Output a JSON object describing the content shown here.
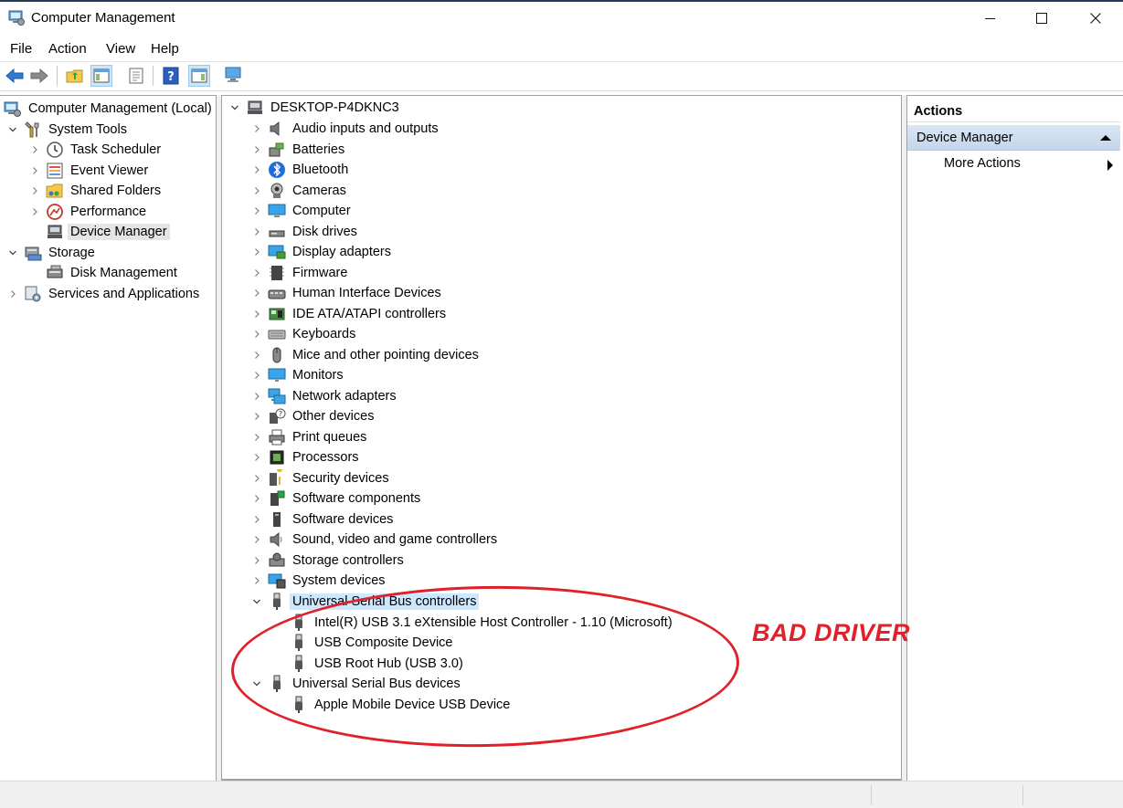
{
  "window": {
    "title": "Computer Management"
  },
  "menu": [
    "File",
    "Action",
    "View",
    "Help"
  ],
  "left_tree": {
    "root": "Computer Management (Local)",
    "system_tools": "System Tools",
    "system_tools_children": [
      "Task Scheduler",
      "Event Viewer",
      "Shared Folders",
      "Performance",
      "Device Manager"
    ],
    "storage": "Storage",
    "storage_children": [
      "Disk Management"
    ],
    "services": "Services and Applications",
    "selected": "Device Manager"
  },
  "device_tree": {
    "computer_name": "DESKTOP-P4DKNC3",
    "categories": [
      {
        "label": "Audio inputs and outputs",
        "icon": "speaker-icon"
      },
      {
        "label": "Batteries",
        "icon": "battery-icon"
      },
      {
        "label": "Bluetooth",
        "icon": "bluetooth-icon"
      },
      {
        "label": "Cameras",
        "icon": "camera-icon"
      },
      {
        "label": "Computer",
        "icon": "computer-icon"
      },
      {
        "label": "Disk drives",
        "icon": "disk-drive-icon"
      },
      {
        "label": "Display adapters",
        "icon": "display-adapter-icon"
      },
      {
        "label": "Firmware",
        "icon": "firmware-icon"
      },
      {
        "label": "Human Interface Devices",
        "icon": "hid-icon"
      },
      {
        "label": "IDE ATA/ATAPI controllers",
        "icon": "ide-controller-icon"
      },
      {
        "label": "Keyboards",
        "icon": "keyboard-icon"
      },
      {
        "label": "Mice and other pointing devices",
        "icon": "mouse-icon"
      },
      {
        "label": "Monitors",
        "icon": "monitor-icon"
      },
      {
        "label": "Network adapters",
        "icon": "network-adapter-icon"
      },
      {
        "label": "Other devices",
        "icon": "other-devices-icon"
      },
      {
        "label": "Print queues",
        "icon": "printer-icon"
      },
      {
        "label": "Processors",
        "icon": "processor-icon"
      },
      {
        "label": "Security devices",
        "icon": "security-device-icon"
      },
      {
        "label": "Software components",
        "icon": "software-component-icon"
      },
      {
        "label": "Software devices",
        "icon": "software-device-icon"
      },
      {
        "label": "Sound, video and game controllers",
        "icon": "sound-controller-icon"
      },
      {
        "label": "Storage controllers",
        "icon": "storage-controller-icon"
      },
      {
        "label": "System devices",
        "icon": "system-device-icon"
      }
    ],
    "usb_controllers": {
      "label": "Universal Serial Bus controllers",
      "children": [
        "Intel(R) USB 3.1 eXtensible Host Controller - 1.10 (Microsoft)",
        "USB Composite Device",
        "USB Root Hub (USB 3.0)"
      ]
    },
    "usb_devices": {
      "label": "Universal Serial Bus devices",
      "children": [
        "Apple Mobile Device USB Device"
      ]
    }
  },
  "actions": {
    "header": "Actions",
    "section": "Device Manager",
    "more": "More Actions"
  },
  "annotation": {
    "text": "BAD DRIVER",
    "color": "#e0202a"
  },
  "colors": {
    "selection_highlight": "#cce8ff",
    "actions_section_bg": "#c9d9ea",
    "window_stripe": "#1f3d59"
  }
}
